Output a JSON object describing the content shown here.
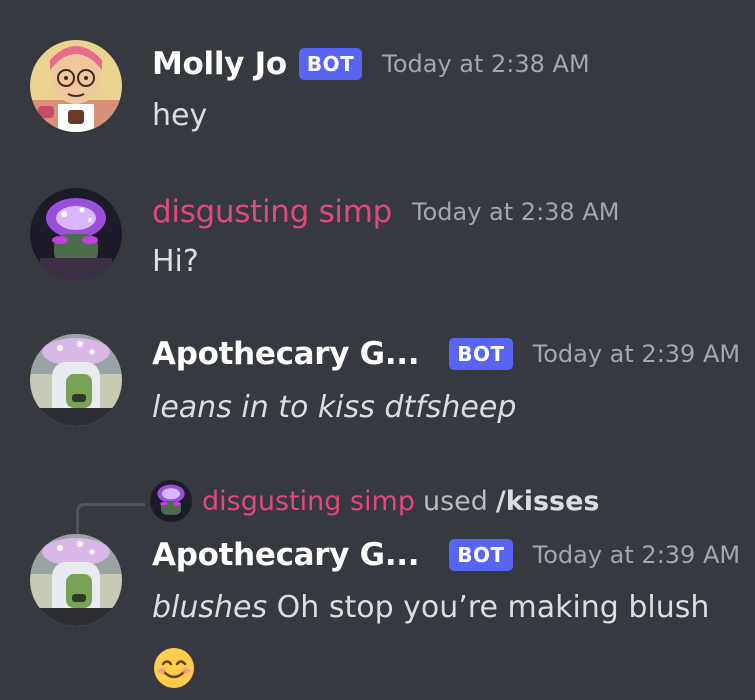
{
  "messages": [
    {
      "username": "Molly Jo",
      "bot_tag": "BOT",
      "timestamp": "Today at 2:38 AM",
      "text": "hey"
    },
    {
      "username": "disgusting simp",
      "timestamp": "Today at 2:38 AM",
      "text": "Hi?"
    },
    {
      "username": "Apothecary G...",
      "bot_tag": "BOT",
      "timestamp": "Today at 2:39 AM",
      "text_italic": "leans in to kiss dtfsheep"
    },
    {
      "reply": {
        "username": "disgusting simp",
        "used": "used",
        "command": "/kisses"
      },
      "username": "Apothecary G...",
      "bot_tag": "BOT",
      "timestamp": "Today at 2:39 AM",
      "text_italic": "blushes",
      "text": " Oh stop you’re making blush",
      "emoji": "smiling-face-with-smiling-eyes"
    }
  ],
  "colors": {
    "background": "#36393f",
    "bot_tag": "#5865f2",
    "username_pink": "#e2497a",
    "timestamp": "#a3a6aa",
    "message_text": "#dcddde"
  }
}
